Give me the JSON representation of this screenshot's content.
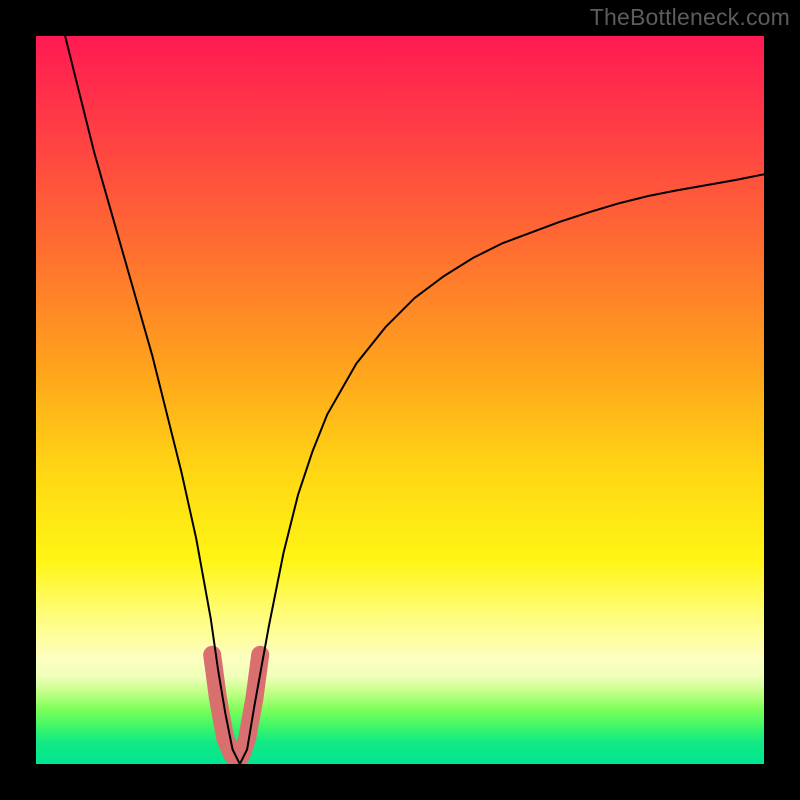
{
  "watermark": "TheBottleneck.com",
  "chart_data": {
    "type": "line",
    "title": "",
    "xlabel": "",
    "ylabel": "",
    "xlim": [
      0,
      100
    ],
    "ylim": [
      0,
      100
    ],
    "grid": false,
    "legend": false,
    "gradient_bands": [
      {
        "name": "red",
        "approx_y_pct_top": 0,
        "color": "#ff1a52"
      },
      {
        "name": "orange",
        "approx_y_pct_top": 35,
        "color": "#ff8a28"
      },
      {
        "name": "yellow",
        "approx_y_pct_top": 65,
        "color": "#fff028"
      },
      {
        "name": "green",
        "approx_y_pct_top": 92,
        "color": "#20e78a"
      }
    ],
    "series": [
      {
        "name": "main-curve",
        "color": "#000000",
        "stroke_width": 2,
        "x": [
          4,
          5,
          6,
          8,
          10,
          12,
          14,
          16,
          18,
          20,
          22,
          24,
          25,
          26,
          27,
          28,
          29,
          30,
          32,
          34,
          36,
          38,
          40,
          44,
          48,
          52,
          56,
          60,
          64,
          68,
          72,
          76,
          80,
          84,
          88,
          92,
          96,
          100
        ],
        "y": [
          100,
          96,
          92,
          84,
          77,
          70,
          63,
          56,
          48,
          40,
          31,
          20,
          13,
          7,
          2,
          0,
          2,
          8,
          19,
          29,
          37,
          43,
          48,
          55,
          60,
          64,
          67,
          69.5,
          71.5,
          73,
          74.5,
          75.8,
          77,
          78,
          78.8,
          79.5,
          80.2,
          81
        ]
      },
      {
        "name": "highlight-u",
        "color": "#d9706f",
        "stroke_width": 18,
        "stroke_linecap": "round",
        "x": [
          24.2,
          25,
          26,
          27,
          27.6,
          28.2,
          29,
          30,
          30.8
        ],
        "y": [
          15,
          9,
          3.5,
          1.2,
          0.8,
          1.2,
          3.5,
          9,
          15
        ]
      }
    ]
  }
}
